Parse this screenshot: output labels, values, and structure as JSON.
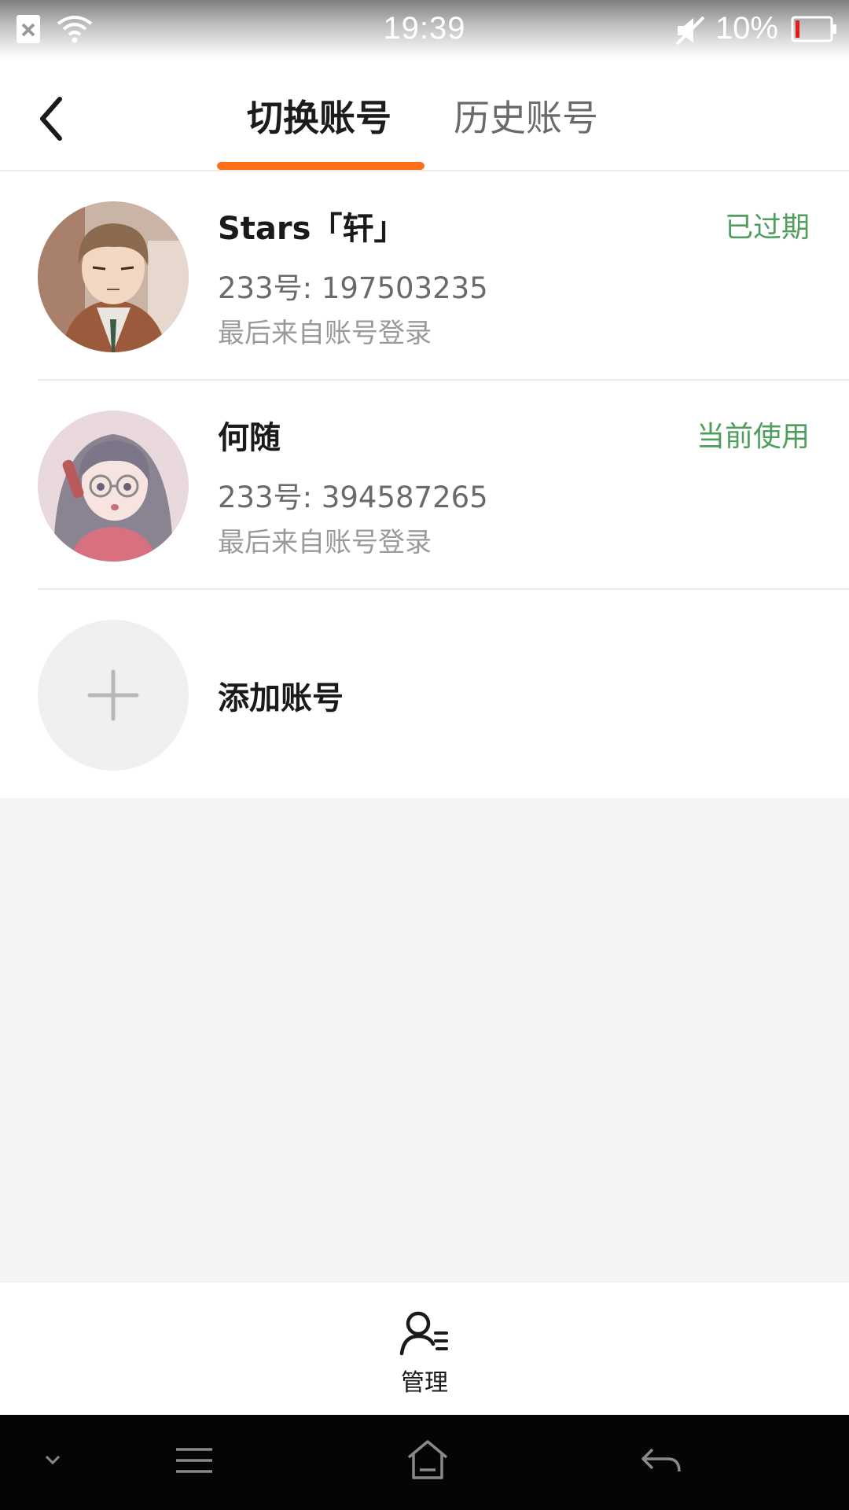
{
  "status_bar": {
    "time": "19:39",
    "battery": "10%"
  },
  "header": {
    "tab_switch": "切换账号",
    "tab_history": "历史账号",
    "active_tab": "切换账号",
    "accent_color": "#ff6f19"
  },
  "accounts": [
    {
      "name": "Stars「轩」",
      "status": "已过期",
      "uid": "233号: 197503235",
      "last_login": "最后来自账号登录"
    },
    {
      "name": "何随",
      "status": "当前使用",
      "uid": "233号: 394587265",
      "last_login": "最后来自账号登录"
    }
  ],
  "add_account": {
    "label": "添加账号"
  },
  "bottom_tab": {
    "manage_label": "管理"
  },
  "colors": {
    "status_green": "#4f9e5e",
    "background": "#f4f4f4"
  }
}
